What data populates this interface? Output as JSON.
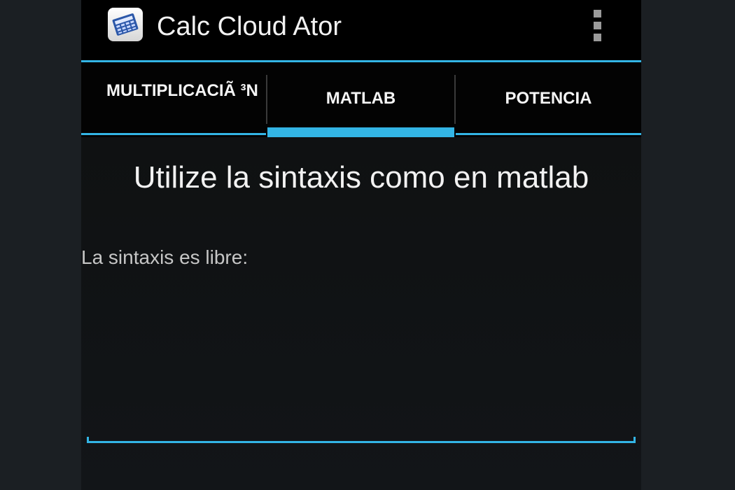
{
  "app": {
    "title": "Calc Cloud Ator",
    "icon": "calculator-icon"
  },
  "action_bar": {
    "overflow_icon": "overflow-menu-icon"
  },
  "tabs": [
    {
      "label": "MULTIPLICACIÃ ³N",
      "selected": false
    },
    {
      "label": "MATLAB",
      "selected": true
    },
    {
      "label": "POTENCIA",
      "selected": false
    }
  ],
  "main": {
    "heading": "Utilize la sintaxis como en matlab",
    "field_label": "La sintaxis es libre:",
    "input_value": "",
    "input_placeholder": ""
  },
  "colors": {
    "accent": "#33b5e5",
    "action_bar": "#000000",
    "background": "#121518"
  }
}
